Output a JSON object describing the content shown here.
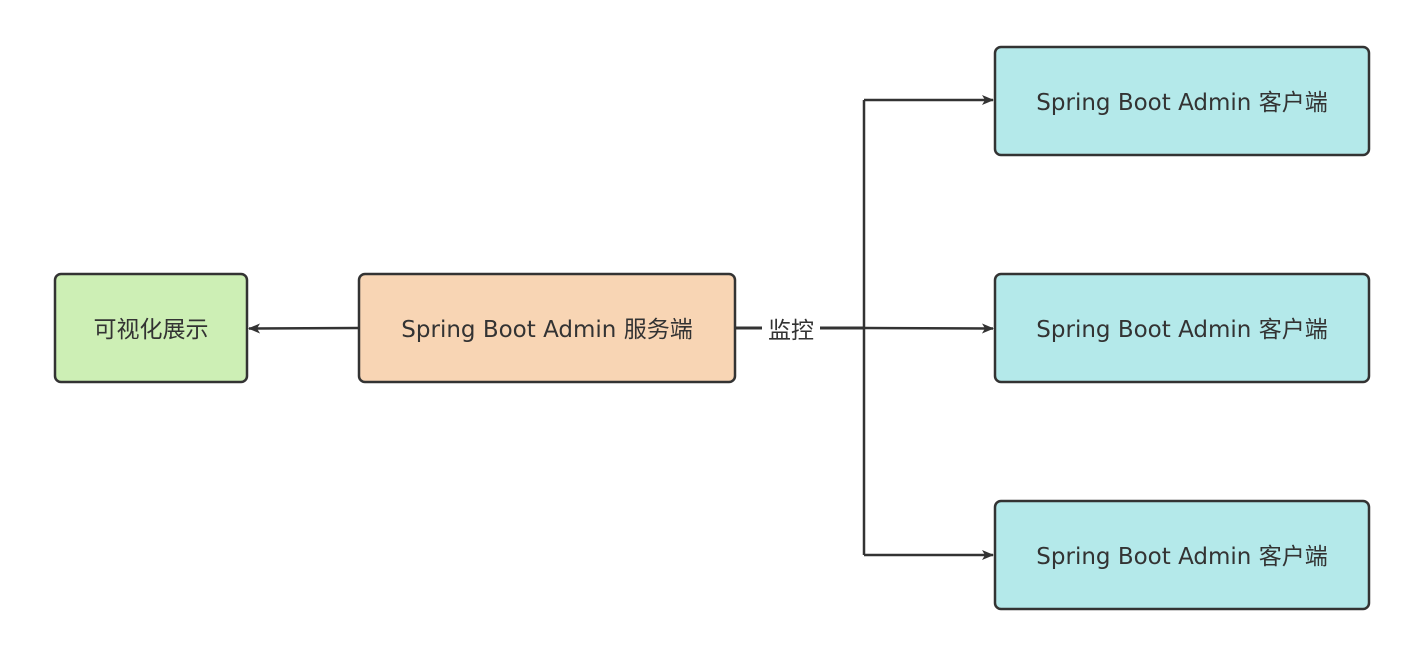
{
  "nodes": {
    "visual": {
      "label": "可视化展示",
      "fill": "#cdefb5"
    },
    "server": {
      "label": "Spring Boot Admin 服务端",
      "fill": "#f8d5b4"
    },
    "client1": {
      "label": "Spring Boot Admin 客户端",
      "fill": "#b4e9ea"
    },
    "client2": {
      "label": "Spring Boot Admin 客户端",
      "fill": "#b4e9ea"
    },
    "client3": {
      "label": "Spring Boot Admin 客户端",
      "fill": "#b4e9ea"
    }
  },
  "edges": {
    "monitor_label": "监控"
  },
  "colors": {
    "stroke": "#333333"
  }
}
